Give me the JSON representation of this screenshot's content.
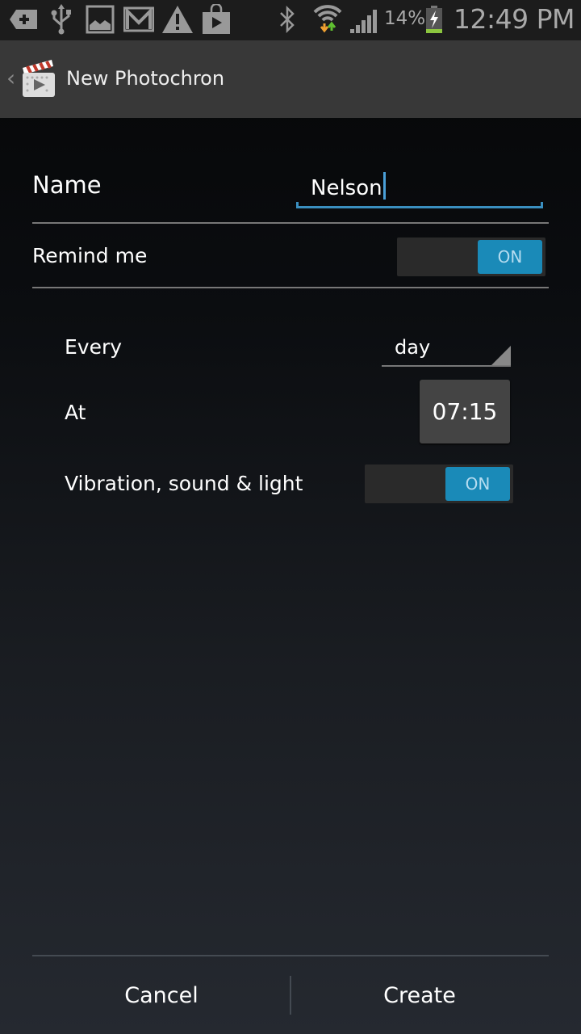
{
  "status_bar": {
    "notification_icons": [
      "add-icon",
      "usb-icon",
      "gallery-icon",
      "gmail-icon",
      "warning-icon",
      "play-store-icon"
    ],
    "system_icons": [
      "bluetooth-icon",
      "wifi-icon",
      "signal-icon"
    ],
    "battery_percent": "14%",
    "battery_charging": true,
    "time": "12:49 PM"
  },
  "action_bar": {
    "title": "New Photochron",
    "app_icon": "clapperboard-icon",
    "back_icon": "chevron-left-icon"
  },
  "form": {
    "name": {
      "label": "Name",
      "value": "Nelson"
    },
    "remind_me": {
      "label": "Remind me",
      "state": "ON"
    },
    "every": {
      "label": "Every",
      "selected": "day"
    },
    "at": {
      "label": "At",
      "time": "07:15"
    },
    "vibration": {
      "label": "Vibration, sound & light",
      "state": "ON"
    }
  },
  "buttons": {
    "cancel": "Cancel",
    "create": "Create"
  },
  "colors": {
    "accent": "#1a8ab8",
    "input_underline": "#3a8fc0"
  }
}
